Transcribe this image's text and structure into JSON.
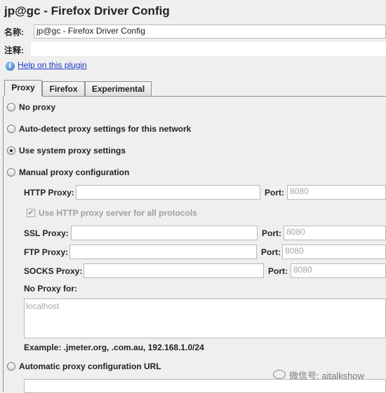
{
  "window": {
    "title": "jp@gc - Firefox Driver Config"
  },
  "name_row": {
    "label": "名称:",
    "value": "jp@gc - Firefox Driver Config"
  },
  "comment_row": {
    "label": "注释:",
    "value": ""
  },
  "help": {
    "label": "Help on this plugin",
    "icon": "help-icon"
  },
  "tabs": [
    {
      "label": "Proxy",
      "active": true
    },
    {
      "label": "Firefox",
      "active": false
    },
    {
      "label": "Experimental",
      "active": false
    }
  ],
  "proxy": {
    "options": {
      "no_proxy": {
        "label": "No proxy",
        "selected": false
      },
      "auto_detect": {
        "label": "Auto-detect proxy settings for this network",
        "selected": false
      },
      "system": {
        "label": "Use system proxy settings",
        "selected": true
      },
      "manual": {
        "label": "Manual proxy configuration",
        "selected": false
      },
      "auto_url": {
        "label": "Automatic proxy configuration URL",
        "selected": false
      }
    },
    "http": {
      "label": "HTTP Proxy:",
      "value": "",
      "port_label": "Port:",
      "port_placeholder": "8080"
    },
    "use_http_all": {
      "label": "Use HTTP proxy server for all protocols",
      "checked": true
    },
    "ssl": {
      "label": "SSL Proxy:",
      "value": "",
      "port_label": "Port:",
      "port_placeholder": "8080"
    },
    "ftp": {
      "label": "FTP Proxy:",
      "value": "",
      "port_label": "Port:",
      "port_placeholder": "8080"
    },
    "socks": {
      "label": "SOCKS Proxy:",
      "value": "",
      "port_label": "Port:",
      "port_placeholder": "8080"
    },
    "no_proxy_for": {
      "label": "No Proxy for:",
      "placeholder": "localhost"
    },
    "example": "Example: .jmeter.org, .com.au, 192.168.1.0/24",
    "auto_url_value": ""
  },
  "watermark": {
    "text": "微信号: aitalkshow"
  },
  "colors": {
    "background": "#efefef",
    "link": "#1b36c9",
    "border": "#8f8f8f"
  }
}
